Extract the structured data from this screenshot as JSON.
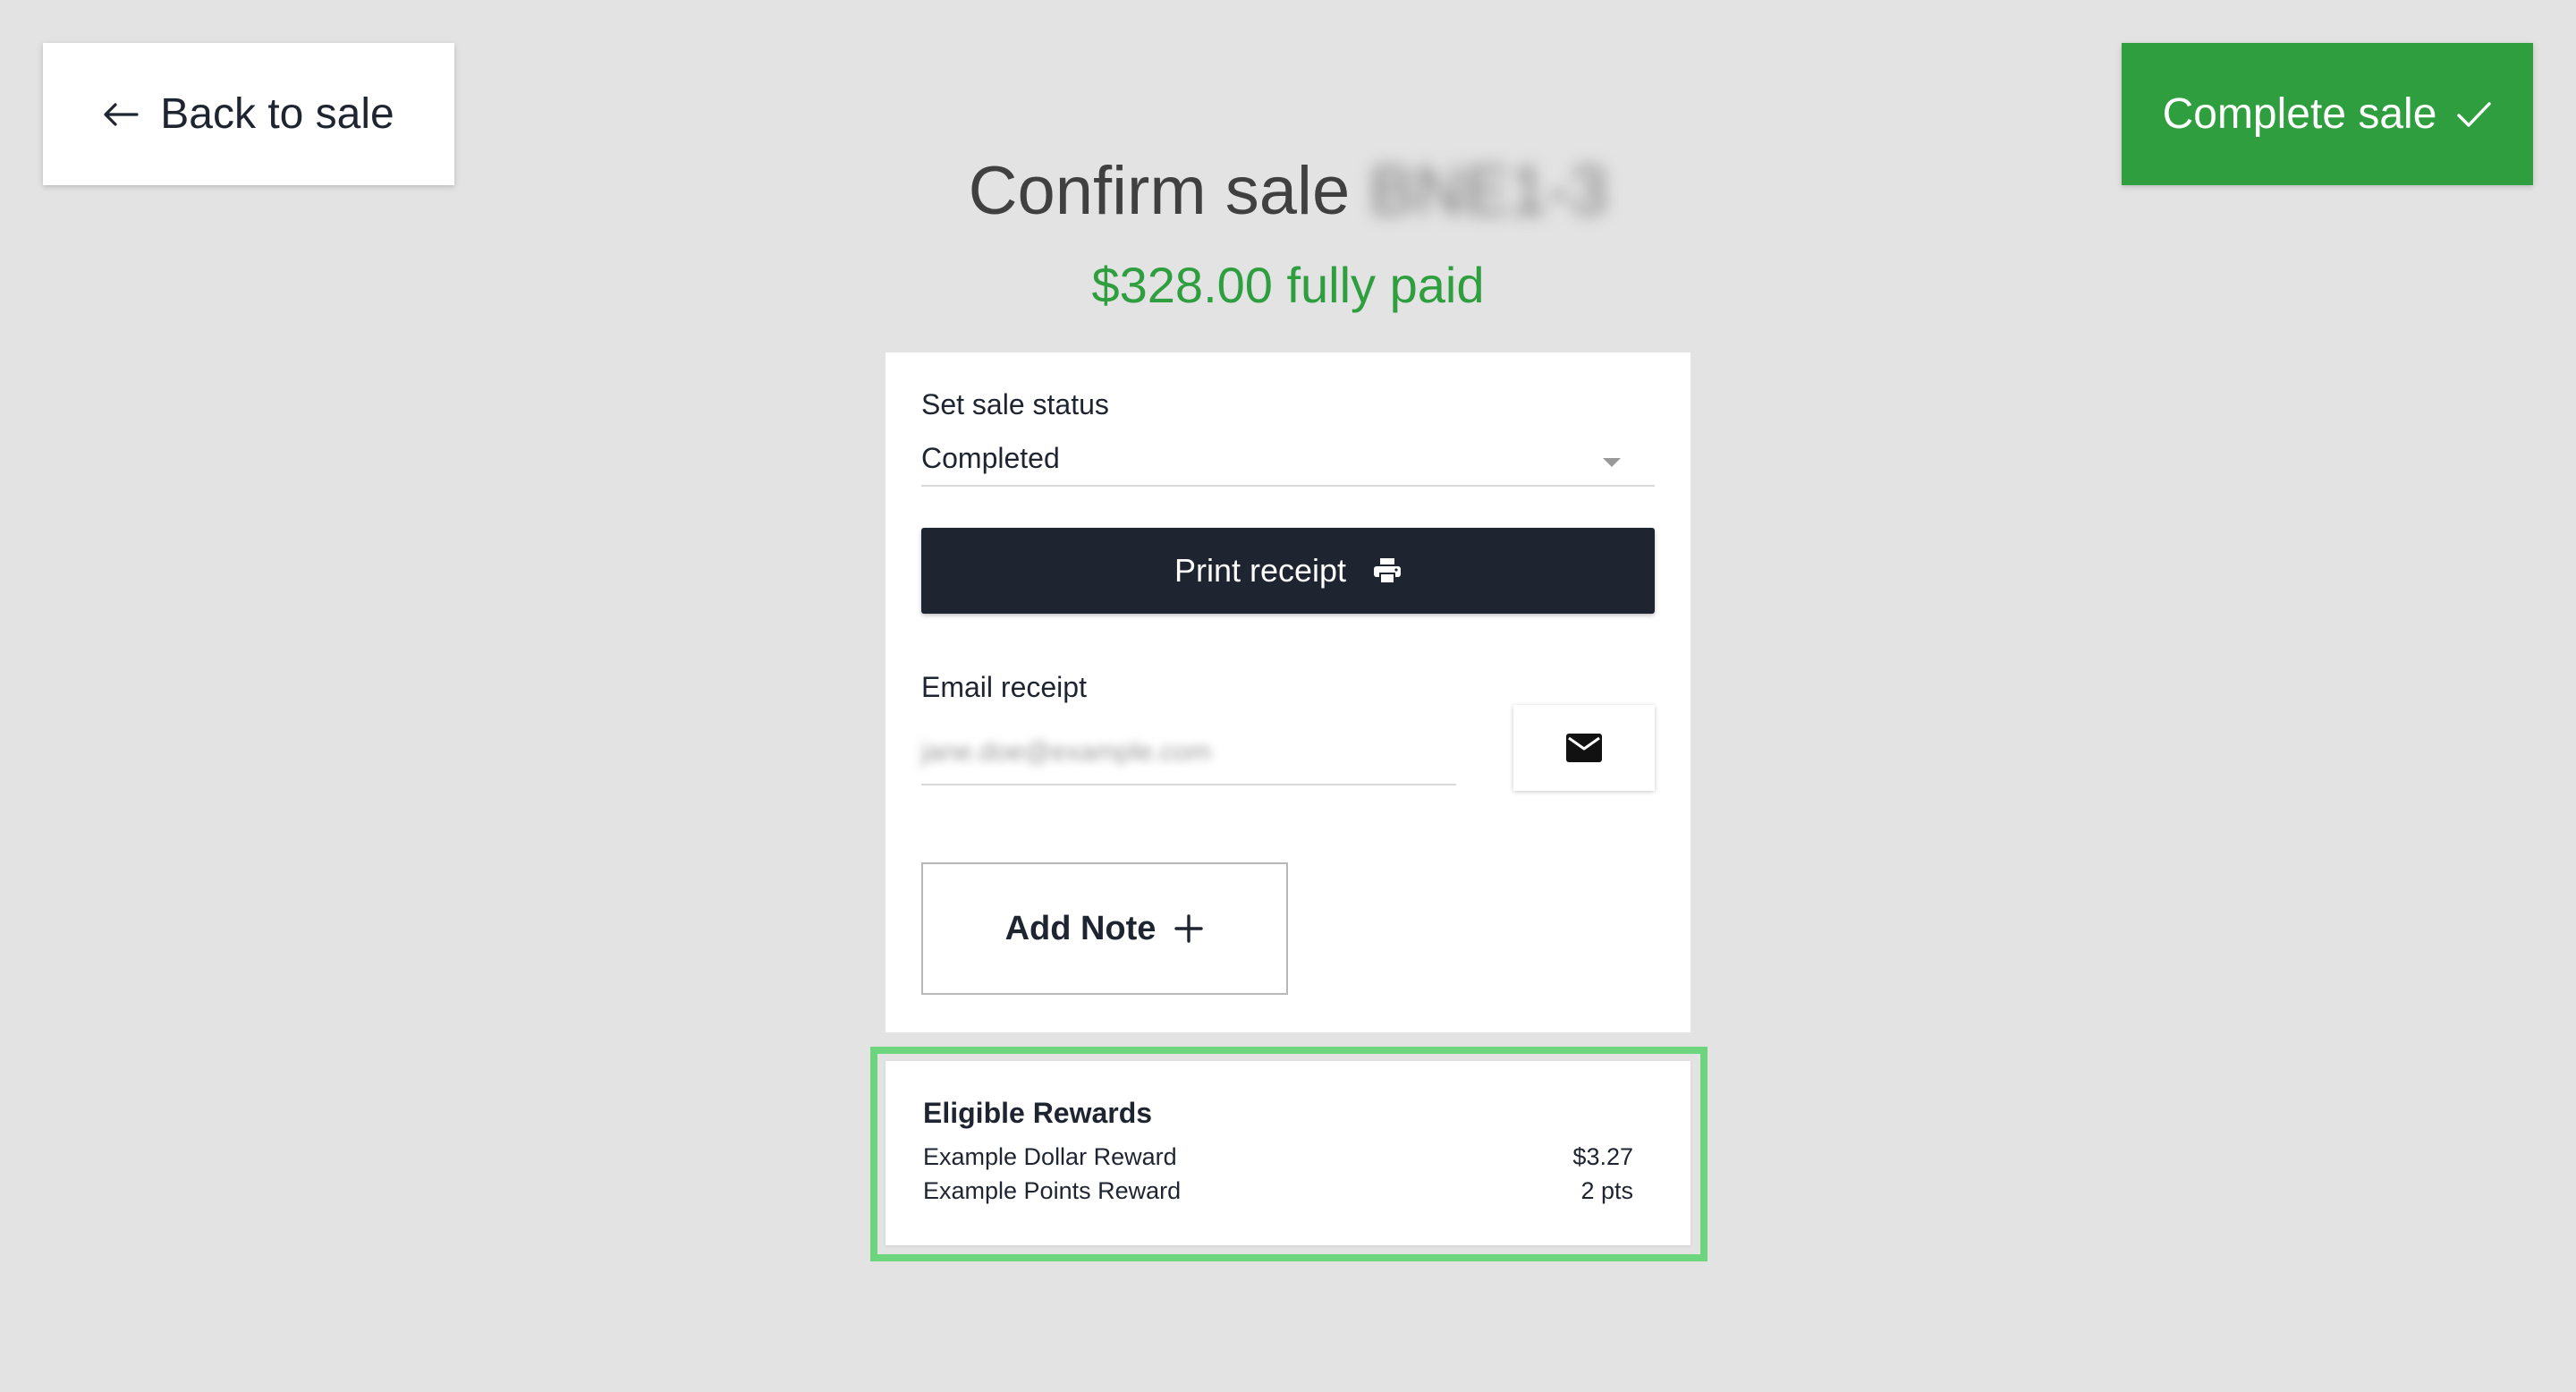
{
  "header": {
    "back_label": "Back to sale",
    "complete_label": "Complete sale",
    "title": "Confirm sale",
    "sale_id": "BNE1-3",
    "paid_summary": "$328.00 fully paid"
  },
  "sale_status": {
    "label": "Set sale status",
    "selected": "Completed"
  },
  "print": {
    "label": "Print receipt"
  },
  "email": {
    "label": "Email receipt",
    "value": "jane.doe@example.com"
  },
  "note": {
    "label": "Add Note"
  },
  "rewards": {
    "title": "Eligible Rewards",
    "items": [
      {
        "name": "Example Dollar Reward",
        "value": "$3.27"
      },
      {
        "name": "Example Points Reward",
        "value": "2 pts"
      }
    ]
  },
  "colors": {
    "background": "#e3e3e3",
    "accent_green": "#2e9e3e",
    "dark_button": "#1f2431",
    "highlight_outline": "#6cd57d"
  },
  "icons": {
    "back": "arrow-left-icon",
    "complete": "check-icon",
    "print": "printer-icon",
    "email": "envelope-icon",
    "note": "plus-icon",
    "select": "chevron-down-icon"
  }
}
